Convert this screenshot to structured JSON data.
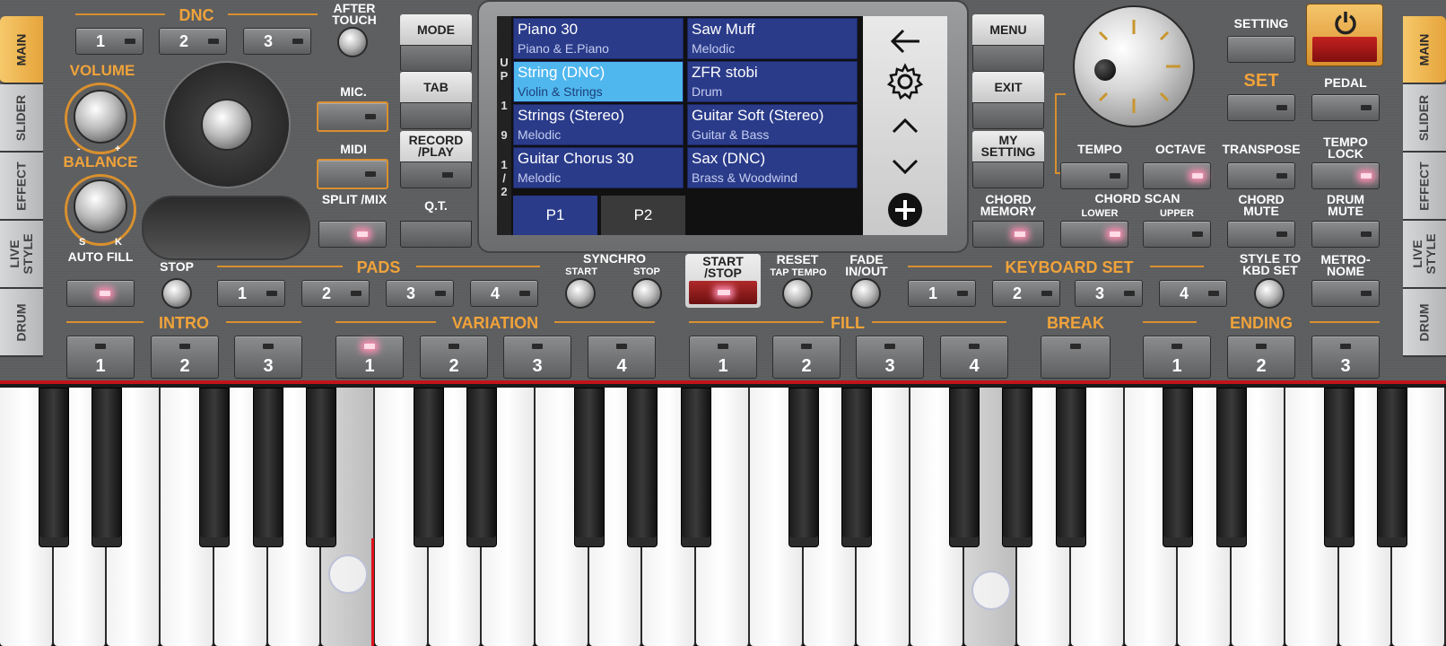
{
  "side_tabs_left": [
    "MAIN",
    "SLIDER",
    "EFFECT",
    "LIVE STYLE",
    "DRUM"
  ],
  "side_tabs_right": [
    "MAIN",
    "SLIDER",
    "EFFECT",
    "LIVE STYLE",
    "DRUM"
  ],
  "active_side_tab": "MAIN",
  "dnc": {
    "title": "DNC",
    "buttons": [
      "1",
      "2",
      "3"
    ],
    "after_touch": "AFTER TOUCH"
  },
  "volume": "VOLUME",
  "volume_minus": "-",
  "volume_plus": "+",
  "balance": "BALANCE",
  "balance_s": "S",
  "balance_k": "K",
  "mic": "MIC.",
  "midi": "MIDI",
  "split_mix": "SPLIT /MIX",
  "mode_column": [
    {
      "label": "MODE"
    },
    {
      "label": "TAB"
    },
    {
      "label": "RECORD /PLAY"
    },
    {
      "label": "Q.T."
    }
  ],
  "menu_column": [
    {
      "label": "MENU"
    },
    {
      "label": "EXIT"
    },
    {
      "label": "MY SETTING"
    },
    {
      "label": "CHORD MEMORY"
    }
  ],
  "screen": {
    "side_letters": [
      "U",
      "P",
      "1",
      "9",
      "1",
      "/",
      "2"
    ],
    "voices": [
      {
        "name": "Piano 30",
        "category": "Piano & E.Piano",
        "selected": false
      },
      {
        "name": "Saw Muff",
        "category": "Melodic",
        "selected": false
      },
      {
        "name": "String (DNC)",
        "category": "Violin & Strings",
        "selected": true
      },
      {
        "name": "ZFR stobi",
        "category": "Drum",
        "selected": false
      },
      {
        "name": "Strings (Stereo)",
        "category": "Melodic",
        "selected": false
      },
      {
        "name": "Guitar Soft (Stereo)",
        "category": "Guitar & Bass",
        "selected": false
      },
      {
        "name": "Guitar Chorus 30",
        "category": "Melodic",
        "selected": false
      },
      {
        "name": "Sax (DNC)",
        "category": "Brass & Woodwind",
        "selected": false
      }
    ],
    "pages": [
      "P1",
      "P2"
    ],
    "active_page": "P1",
    "nav_icons": [
      "back-arrow-icon",
      "gear-icon",
      "chevron-up-icon",
      "chevron-down-icon",
      "plus-circle-icon"
    ]
  },
  "right_panel": {
    "setting": "SETTING",
    "set": "SET",
    "pedal": "PEDAL",
    "tempo": "TEMPO",
    "octave": "OCTAVE",
    "transpose": "TRANSPOSE",
    "tempo_lock": "TEMPO LOCK",
    "chord_scan": "CHORD SCAN",
    "lower": "LOWER",
    "upper": "UPPER",
    "chord_mute": "CHORD MUTE",
    "drum_mute": "DRUM MUTE"
  },
  "pads_row": {
    "auto_fill": "AUTO FILL",
    "stop": "STOP",
    "pads_title": "PADS",
    "pads": [
      "1",
      "2",
      "3",
      "4"
    ],
    "synchro": "SYNCHRO",
    "synchro_start": "START",
    "synchro_stop": "STOP",
    "start_stop": "START /STOP",
    "reset": "RESET",
    "tap_tempo": "TAP TEMPO",
    "fade": "FADE IN/OUT",
    "keyboard_set_title": "KEYBOARD SET",
    "keyboard_set": [
      "1",
      "2",
      "3",
      "4"
    ],
    "style_to_kbd": "STYLE TO KBD SET",
    "metronome": "METRO- NOME"
  },
  "style_row": {
    "intro_title": "INTRO",
    "intro": [
      "1",
      "2",
      "3"
    ],
    "variation_title": "VARIATION",
    "variation": [
      "1",
      "2",
      "3",
      "4"
    ],
    "fill_title": "FILL",
    "fill": [
      "1",
      "2",
      "3",
      "4"
    ],
    "break_title": "BREAK",
    "ending_title": "ENDING",
    "ending": [
      "1",
      "2",
      "3"
    ]
  },
  "keyboard": {
    "white_keys": 27,
    "pressed_keys": [
      6,
      18
    ]
  },
  "colors": {
    "accent": "#f0a33a",
    "screen_voice": "#2a3b8a",
    "selected_voice": "#4fb7ee",
    "led_on": "#ff8fb3",
    "power": "#c42020"
  }
}
